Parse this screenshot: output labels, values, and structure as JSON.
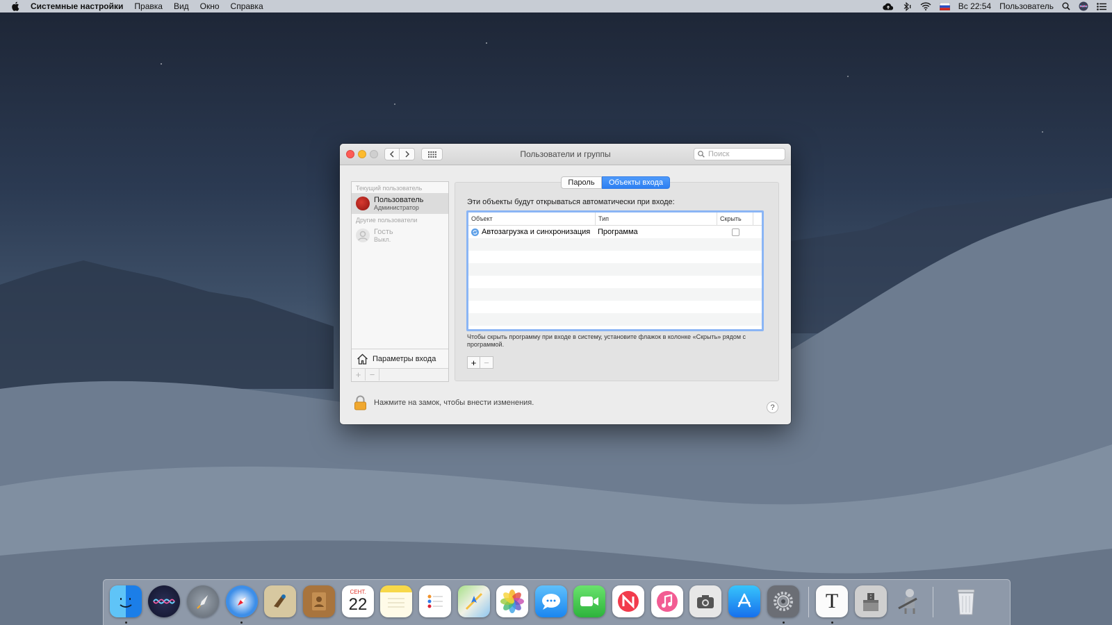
{
  "menubar": {
    "app_name": "Системные настройки",
    "items": [
      "Правка",
      "Вид",
      "Окно",
      "Справка"
    ],
    "clock": "Вс 22:54",
    "user": "Пользователь"
  },
  "window": {
    "title": "Пользователи и группы",
    "search_placeholder": "Поиск"
  },
  "sidebar": {
    "current_header": "Текущий пользователь",
    "current_user": {
      "name": "Пользователь",
      "role": "Администратор"
    },
    "other_header": "Другие пользователи",
    "guest": {
      "name": "Гость",
      "role": "Выкл."
    },
    "login_options": "Параметры входа"
  },
  "tabs": {
    "password": "Пароль",
    "login_items": "Объекты входа"
  },
  "login_items": {
    "intro": "Эти объекты будут открываться автоматически при входе:",
    "columns": {
      "item": "Объект",
      "type": "Тип",
      "hide": "Скрыть"
    },
    "rows": [
      {
        "item": "Автозагрузка и синхронизация",
        "type": "Программа",
        "hidden": false
      }
    ],
    "hint": "Чтобы скрыть программу при входе в систему, установите флажок в колонке «Скрыть» рядом с программой.",
    "add": "+",
    "remove": "−"
  },
  "footer": {
    "lock_text": "Нажмите на замок, чтобы внести изменения.",
    "help": "?"
  },
  "dock": {
    "calendar_month": "СЕНТ.",
    "calendar_day": "22",
    "textedit_letter": "T"
  }
}
